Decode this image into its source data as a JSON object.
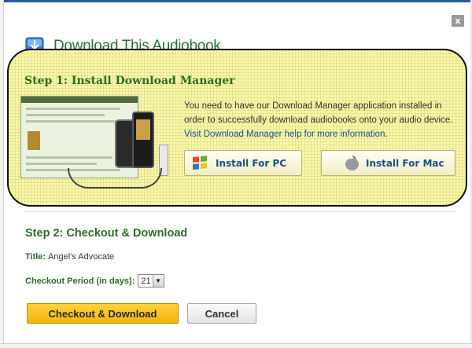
{
  "dialog": {
    "title": "Download This Audiobook",
    "close_label": "x"
  },
  "step1": {
    "heading": "Step 1: Install Download Manager",
    "description": "You need to have our Download Manager application installed in order to successfully download audiobooks onto your audio device.",
    "help_link": "Visit Download Manager help for more information",
    "help_link_suffix": ".",
    "install_pc_label": "Install For PC",
    "install_mac_label": "Install For Mac"
  },
  "step2": {
    "heading": "Step 2: Checkout & Download",
    "title_label": "Title:",
    "title_value": "Angel's Advocate",
    "period_label": "Checkout Period (in days):",
    "period_value": "21",
    "checkout_label": "Checkout & Download",
    "cancel_label": "Cancel"
  },
  "icons": {
    "dialog_icon": "download-icon",
    "close_icon": "close-icon",
    "pc_icon": "windows-logo-icon",
    "mac_icon": "apple-logo-icon",
    "select_arrow": "chevron-down-icon"
  },
  "colors": {
    "heading_green": "#2e6b2a",
    "link_blue": "#1a4f9c",
    "highlight_yellow": "#faf8a8",
    "checkout_orange": "#f5b40a"
  }
}
